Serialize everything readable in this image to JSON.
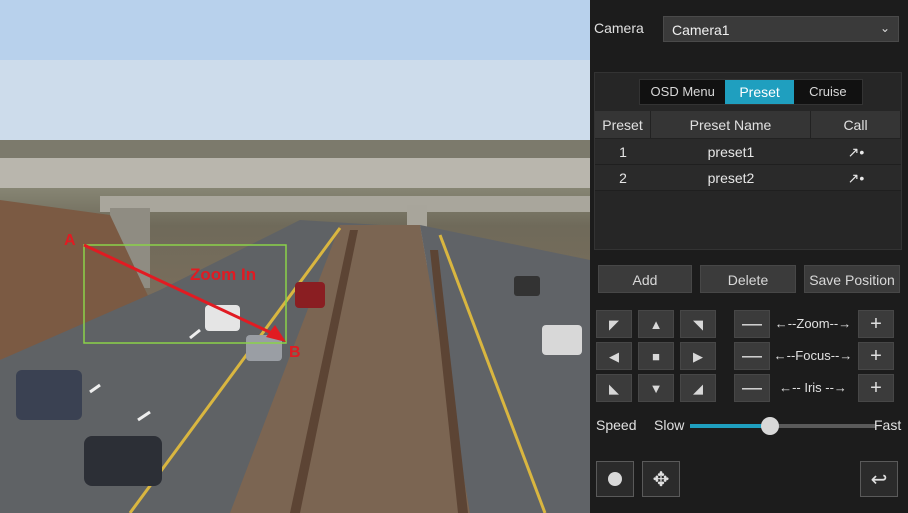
{
  "video": {
    "annotations": {
      "zoom_label": "Zoom In",
      "point_a": "A",
      "point_b": "B"
    },
    "colors": {
      "annotation_red": "#e11b22",
      "zoom_box": "#8bd24a"
    }
  },
  "panel": {
    "camera_label": "Camera",
    "camera_value": "Camera1",
    "tabs": [
      {
        "label": "OSD Menu",
        "active": false
      },
      {
        "label": "Preset",
        "active": true
      },
      {
        "label": "Cruise",
        "active": false
      }
    ],
    "table": {
      "headers": [
        "Preset",
        "Preset Name",
        "Call"
      ],
      "rows": [
        {
          "preset": "1",
          "name": "preset1",
          "call_icon": "call-arrow-icon"
        },
        {
          "preset": "2",
          "name": "preset2",
          "call_icon": "call-arrow-icon"
        }
      ]
    },
    "buttons": {
      "add": "Add",
      "delete": "Delete",
      "save_position": "Save Position"
    },
    "ptz": {
      "zoom": "←--Zoom--→",
      "focus": "←--Focus--→",
      "iris": "←-- Iris --→"
    },
    "speed": {
      "label": "Speed",
      "slow": "Slow",
      "fast": "Fast",
      "value": 0.43
    },
    "accent": "#1f9fbf"
  }
}
